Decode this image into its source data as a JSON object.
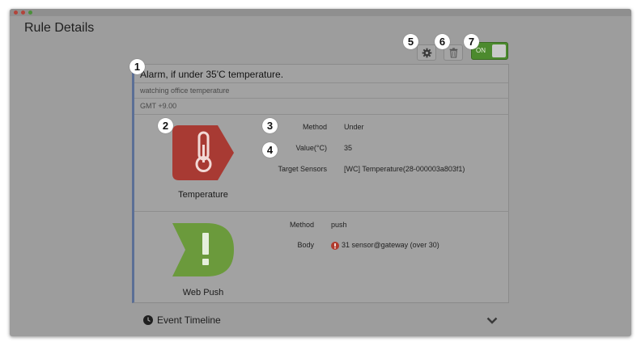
{
  "window": {
    "traffic_lights": [
      "#c0392b",
      "#c0392b",
      "#4a8f3a"
    ]
  },
  "page": {
    "title": "Rule Details"
  },
  "toolbar": {
    "settings_icon": "gear-icon",
    "delete_icon": "trash-icon",
    "toggle_label": "ON",
    "toggle_state": true,
    "accent": "#4c8a2e"
  },
  "rule": {
    "title": "Alarm, if under 35'C temperature.",
    "description": "watching office temperature",
    "timezone": "GMT +9.00"
  },
  "condition": {
    "caption": "Temperature",
    "icon": "thermometer-icon",
    "color": "#a83a33",
    "fields": [
      {
        "label": "Method",
        "value": "Under"
      },
      {
        "label": "Value(°C)",
        "value": "35"
      },
      {
        "label": "Target Sensors",
        "value": "[WC] Temperature(28-000003a803f1)"
      }
    ]
  },
  "action": {
    "caption": "Web Push",
    "icon": "exclamation-icon",
    "color": "#6b9a3c",
    "fields": [
      {
        "label": "Method",
        "value": "push"
      },
      {
        "label": "Body",
        "value": "31 sensor@gateway (over 30)"
      }
    ]
  },
  "timeline": {
    "title": "Event Timeline",
    "icon": "clock-icon",
    "expand_icon": "chevron-down-icon"
  },
  "callouts": [
    "1",
    "2",
    "3",
    "4",
    "5",
    "6",
    "7"
  ]
}
